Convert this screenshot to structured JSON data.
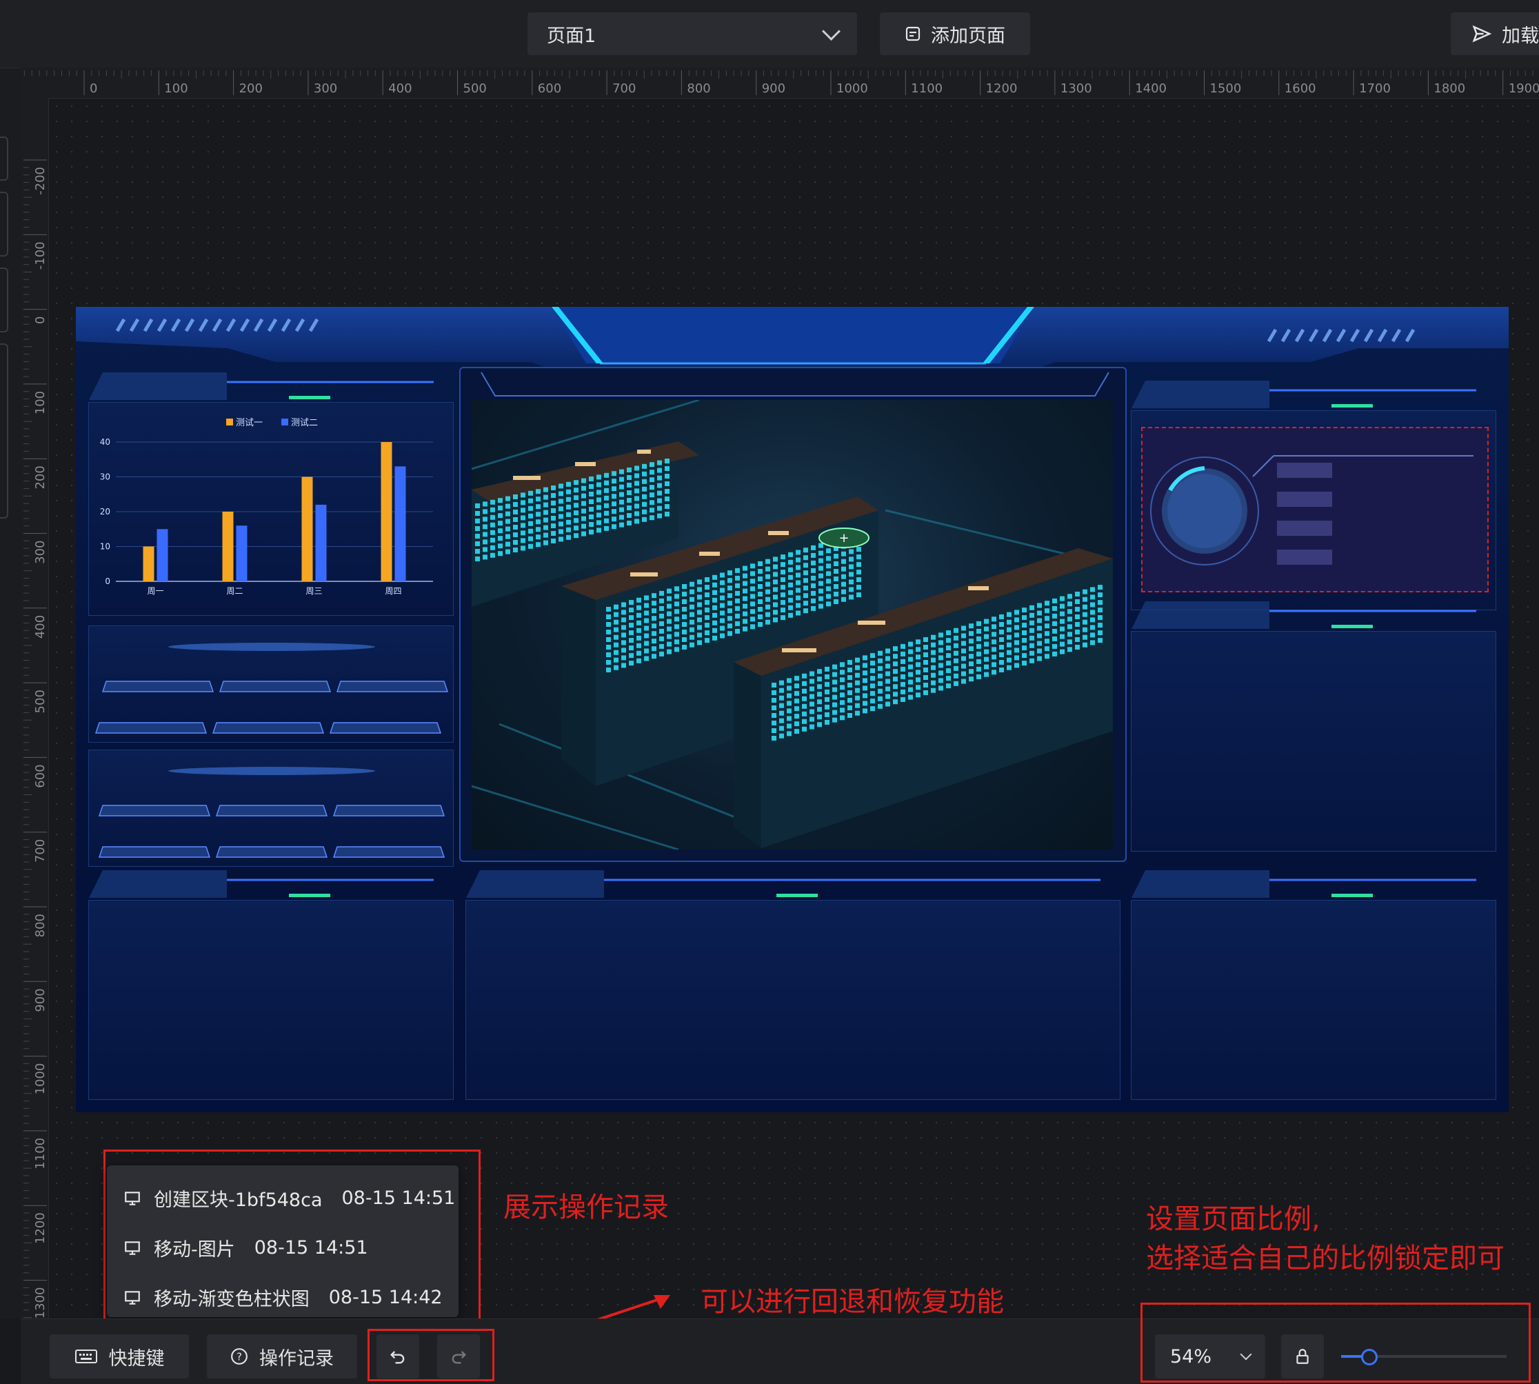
{
  "toolbar": {
    "page_select_value": "页面1",
    "add_page_label": "添加页面",
    "publish_label": "加载"
  },
  "ruler": {
    "h_ticks": [
      "0",
      "100",
      "200",
      "300",
      "400",
      "500",
      "600",
      "700",
      "800",
      "900",
      "1000",
      "1100",
      "1200",
      "1300",
      "1400",
      "1500",
      "1600",
      "1700",
      "1800",
      "1900"
    ],
    "v_ticks": [
      "-200",
      "-100",
      "0",
      "100",
      "200",
      "300",
      "400",
      "500",
      "600",
      "700",
      "800",
      "900",
      "1000",
      "1100",
      "1200",
      "1300"
    ]
  },
  "artboard": {
    "chart": {
      "legend": [
        "测试一",
        "测试二"
      ]
    }
  },
  "chart_data": {
    "type": "bar",
    "categories": [
      "周一",
      "周二",
      "周三",
      "周四"
    ],
    "series": [
      {
        "name": "测试一",
        "values": [
          10,
          20,
          30,
          40
        ],
        "color": "#f5a623"
      },
      {
        "name": "测试二",
        "values": [
          15,
          16,
          22,
          33
        ],
        "color": "#3a6bff"
      }
    ],
    "ylim": [
      0,
      40
    ],
    "yticks": [
      "0",
      "10",
      "20",
      "30",
      "40"
    ]
  },
  "history": {
    "items": [
      {
        "label": "创建区块-1bf548ca",
        "time": "08-15 14:51"
      },
      {
        "label": "移动-图片",
        "time": "08-15 14:51"
      },
      {
        "label": "移动-渐变色柱状图",
        "time": "08-15 14:42"
      }
    ]
  },
  "annotations": {
    "history_note": "展示操作记录",
    "undo_note": "可以进行回退和恢复功能",
    "zoom_note_1": "设置页面比例,",
    "zoom_note_2": "选择适合自己的比例锁定即可"
  },
  "bottombar": {
    "shortcuts_label": "快捷键",
    "history_label": "操作记录",
    "zoom_value": "54%",
    "zoom_slider_value": 0.16
  },
  "colors": {
    "accent": "#3a73ff",
    "annotation_red": "#e0201e",
    "bg": "#18191d"
  }
}
